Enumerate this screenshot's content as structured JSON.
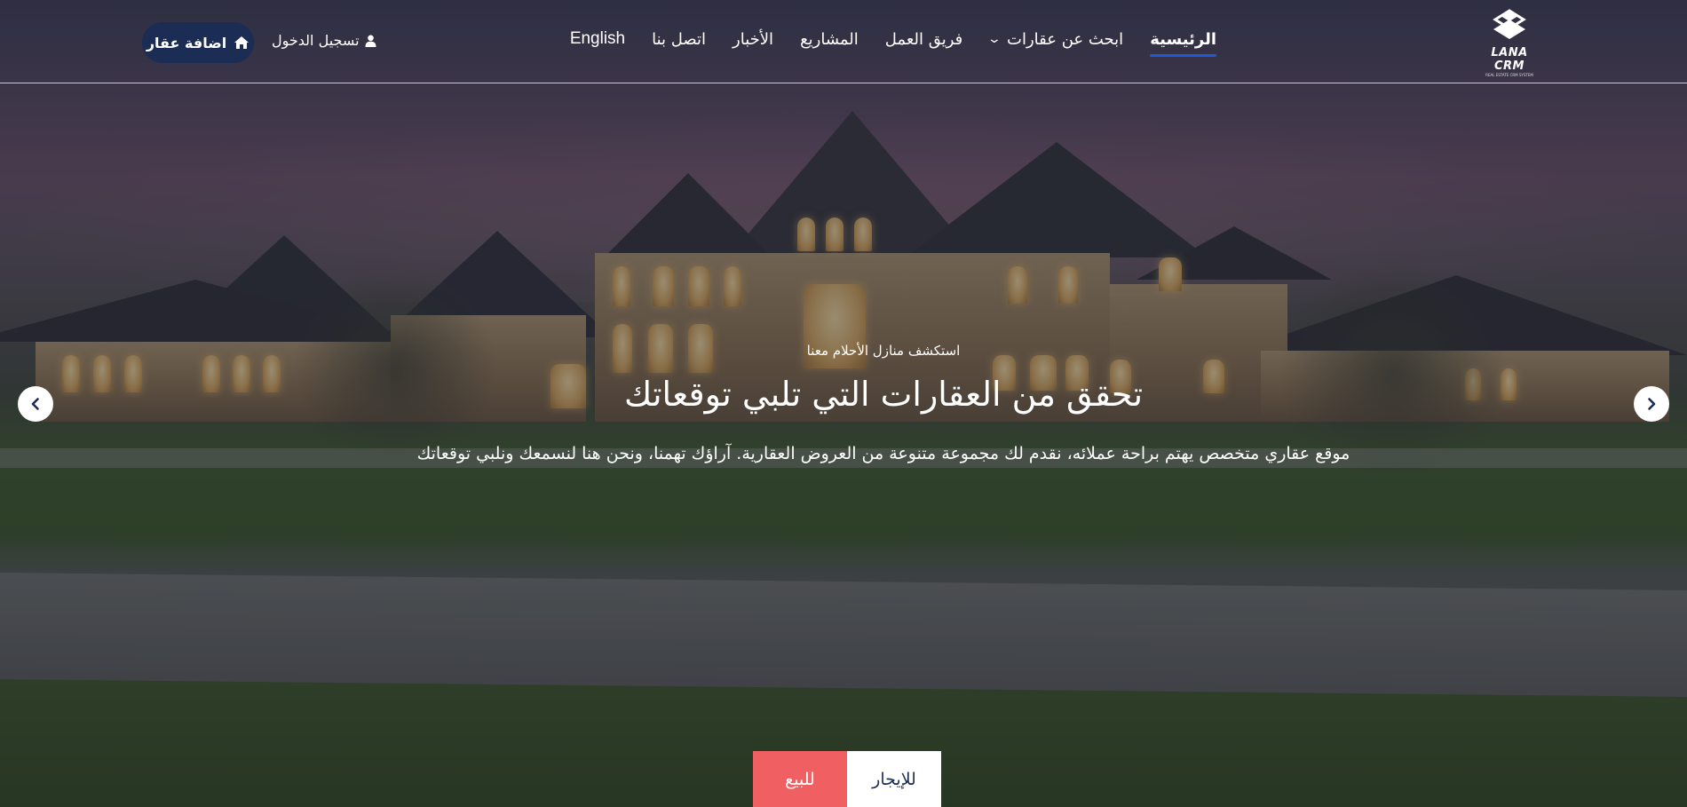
{
  "header": {
    "logo": {
      "name": "LANA CRM",
      "tagline": "REAL ESTATE CRM SYSTEM"
    },
    "nav": [
      {
        "label": "الرئيسية",
        "active": true
      },
      {
        "label": "ابحث عن عقارات",
        "has_dropdown": true
      },
      {
        "label": "فريق العمل"
      },
      {
        "label": "المشاريع"
      },
      {
        "label": "الأخبار"
      },
      {
        "label": "اتصل بنا"
      },
      {
        "label": "English"
      }
    ],
    "login_label": "تسجيل الدخول",
    "add_property_label": "اضافة عقار"
  },
  "hero": {
    "eyebrow": "استكشف منازل الأحلام معنا",
    "headline": "تحقق من العقارات التي تلبي توقعاتك",
    "subline": "موقع عقاري متخصص يهتم براحة عملائه، نقدم لك مجموعة متنوعة من العروض العقارية. آراؤك تهمنا، ونحن هنا لنسمعك ونلبي توقعاتك"
  },
  "tabs": [
    {
      "label": "للبيع",
      "active": true
    },
    {
      "label": "للإيجار",
      "active": false
    }
  ],
  "colors": {
    "nav_active_underline": "#1e5ad6",
    "add_button_bg": "#1b2c55",
    "sale_tab_bg": "#f05f62",
    "rent_tab_bg": "#ffffff",
    "rent_tab_text": "#1b2c55"
  },
  "icons": {
    "logo": "lana-crm-logo",
    "user": "user-icon",
    "home": "home-icon",
    "chevron": "chevron-down-icon",
    "prev": "chevron-left-icon",
    "next": "chevron-right-icon"
  }
}
